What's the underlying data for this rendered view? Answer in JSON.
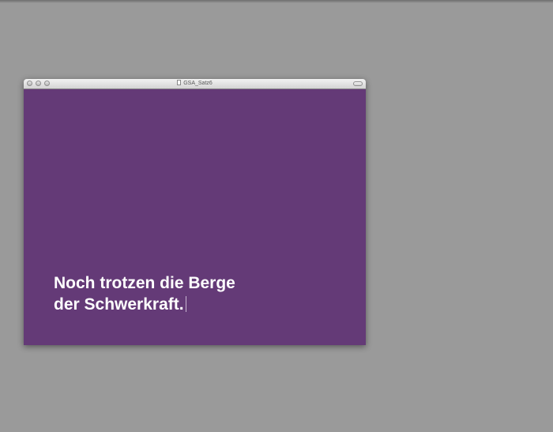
{
  "window": {
    "title": "GSA_Satz6"
  },
  "slide": {
    "line1": "Noch trotzen die Berge",
    "line2": "der Schwerkraft."
  },
  "colors": {
    "desktop": "#9a9a9a",
    "slide_background": "#643a77",
    "text": "#ffffff"
  },
  "icons": {
    "close": "close-icon",
    "minimize": "minimize-icon",
    "zoom": "zoom-icon",
    "document": "document-icon",
    "toolbar_toggle": "toolbar-toggle-icon"
  }
}
